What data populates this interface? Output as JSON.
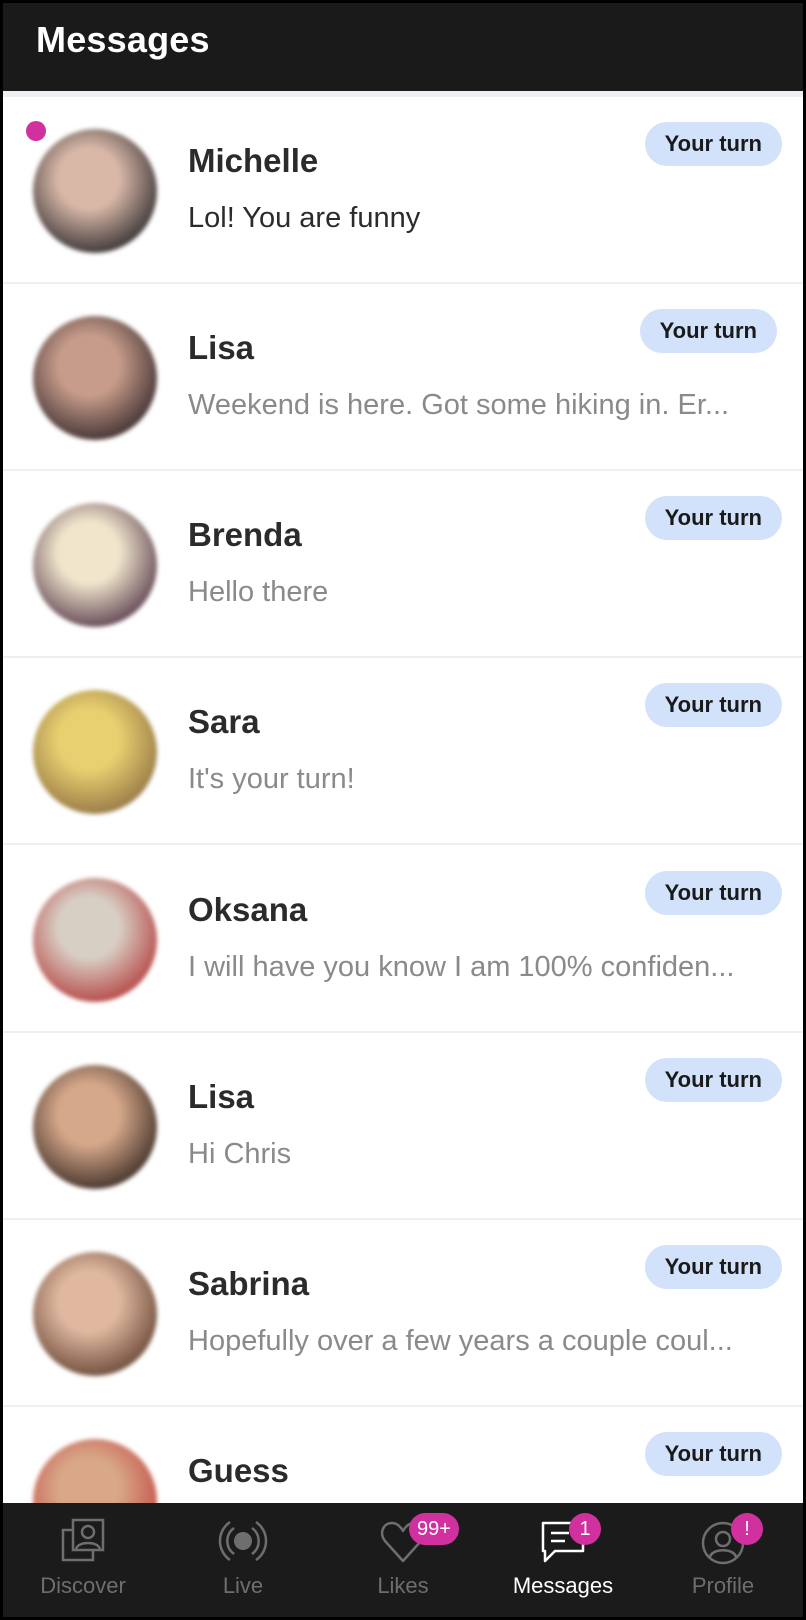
{
  "header": {
    "title": "Messages"
  },
  "colors": {
    "accent": "#d1309f",
    "pill_bg": "#d3e2fb",
    "header_bg": "#1a1a1a",
    "nav_bg": "#1b1b1b",
    "name_text": "#2b2b2b",
    "preview_text": "#8a8a8a"
  },
  "conversations": [
    {
      "name": "Michelle",
      "preview": "Lol! You are funny",
      "status": "Your turn",
      "unread": true,
      "avatar_colors": [
        "#d9b8a8",
        "#1e1e22"
      ]
    },
    {
      "name": "Lisa",
      "preview": "Weekend is here. Got some hiking in. Er...",
      "status": "Your turn",
      "unread": false,
      "avatar_colors": [
        "#c79c8a",
        "#2a2024"
      ]
    },
    {
      "name": "Brenda",
      "preview": "Hello there",
      "status": "Your turn",
      "unread": false,
      "avatar_colors": [
        "#f0e6cc",
        "#4a2a40"
      ]
    },
    {
      "name": "Sara",
      "preview": "It's your turn!",
      "status": "Your turn",
      "unread": false,
      "avatar_colors": [
        "#e8d070",
        "#8a6a40"
      ]
    },
    {
      "name": "Oksana",
      "preview": "I will have you know I am 100% confiden...",
      "status": "Your turn",
      "unread": false,
      "avatar_colors": [
        "#d8cfc4",
        "#b03030"
      ]
    },
    {
      "name": "Lisa",
      "preview": "Hi Chris",
      "status": "Your turn",
      "unread": false,
      "avatar_colors": [
        "#d6a88a",
        "#2a1e1a"
      ]
    },
    {
      "name": "Sabrina",
      "preview": "Hopefully over a few years a couple coul...",
      "status": "Your turn",
      "unread": false,
      "avatar_colors": [
        "#e0b8a0",
        "#5a3a2a"
      ]
    },
    {
      "name": "Guess",
      "preview": "",
      "status": "Your turn",
      "unread": false,
      "avatar_colors": [
        "#d8a888",
        "#c04040"
      ]
    }
  ],
  "nav": {
    "items": [
      {
        "label": "Discover",
        "icon": "discover-icon",
        "active": false,
        "badge": ""
      },
      {
        "label": "Live",
        "icon": "live-icon",
        "active": false,
        "badge": ""
      },
      {
        "label": "Likes",
        "icon": "heart-icon",
        "active": false,
        "badge": "99+"
      },
      {
        "label": "Messages",
        "icon": "chat-icon",
        "active": true,
        "badge": "1"
      },
      {
        "label": "Profile",
        "icon": "profile-icon",
        "active": false,
        "badge": "!"
      }
    ]
  }
}
